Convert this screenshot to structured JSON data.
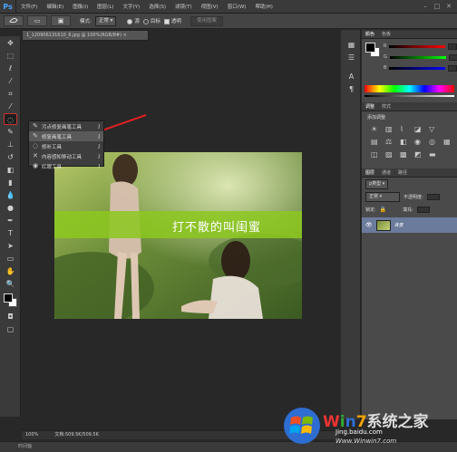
{
  "app": {
    "logo": "Ps"
  },
  "menu": [
    "文件(F)",
    "编辑(E)",
    "图像(I)",
    "图层(L)",
    "文字(Y)",
    "选择(S)",
    "滤镜(T)",
    "视图(V)",
    "窗口(W)",
    "帮助(H)"
  ],
  "window_controls": {
    "minimize": "–",
    "restore": "□",
    "close": "✕"
  },
  "options": {
    "mode_label": "模式:",
    "mode_value": "正常",
    "source_label": "源",
    "pattern_label": "目标",
    "transparent_label": "透明",
    "use_pattern_button": "使用图案"
  },
  "document": {
    "tab_title": "1_120906131610_6.jpg @ 100%(RGB/8#)",
    "banner_text": "打不散的叫闺蜜"
  },
  "flyout": [
    {
      "icon": "spot-healing-brush-icon",
      "label": "污点修复画笔工具",
      "shortcut": "J"
    },
    {
      "icon": "healing-brush-icon",
      "label": "修复画笔工具",
      "shortcut": "J"
    },
    {
      "icon": "patch-icon",
      "label": "修补工具",
      "shortcut": "J"
    },
    {
      "icon": "content-aware-move-icon",
      "label": "内容感知移动工具",
      "shortcut": "J"
    },
    {
      "icon": "red-eye-icon",
      "label": "红眼工具",
      "shortcut": "J"
    }
  ],
  "panels": {
    "color_tab": "颜色",
    "swatches_tab": "色板",
    "r_label": "R",
    "g_label": "G",
    "b_label": "B",
    "adjust_tab": "调整",
    "styles_tab": "样式",
    "adjust_title": "添加调整",
    "layers_tab": "图层",
    "channels_tab": "通道",
    "paths_tab": "路径",
    "kind_label": "ρ类型",
    "blend_mode": "正常",
    "opacity_label": "不透明度:",
    "lock_label": "锁定:",
    "fill_label": "填充:",
    "layer_name": "背景"
  },
  "status": {
    "zoom": "100%",
    "doc_size": "文档:509.5K/509.5K"
  },
  "bottom_label": "时间轴",
  "watermark": {
    "brand": "Win7系统之家",
    "url": "Jing.baidu.com",
    "site": "Www.Winwin7.com"
  }
}
